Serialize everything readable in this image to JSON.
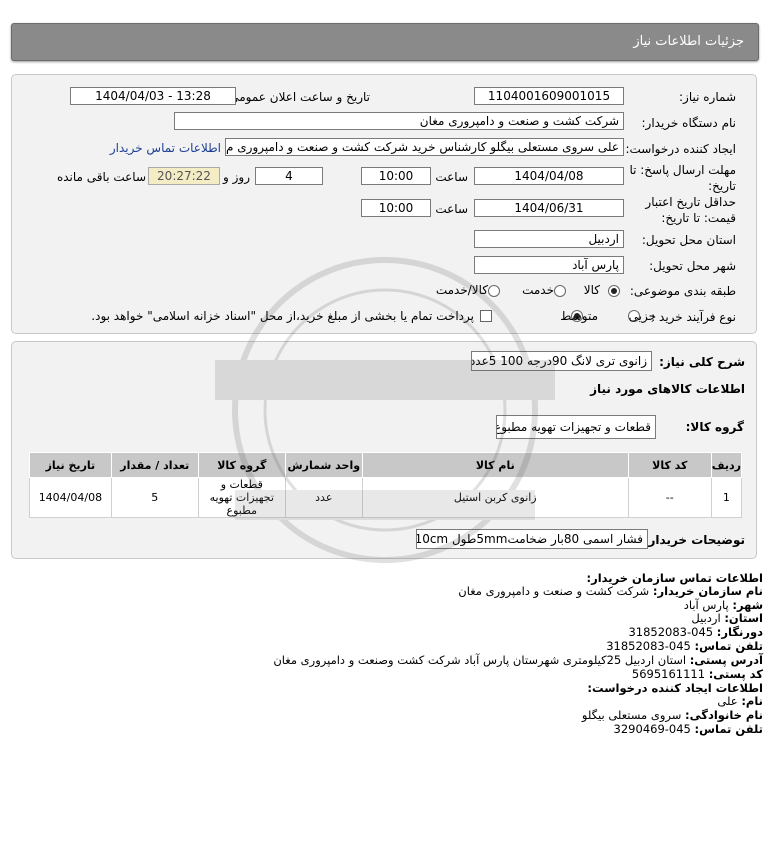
{
  "header": {
    "title": "جزئیات اطلاعات نیاز"
  },
  "details": {
    "need_number_label": "شماره نیاز:",
    "need_number": "1104001609001015",
    "announce_label": "تاریخ و ساعت اعلان عمومی:",
    "announce_value": "1404/04/03 - 13:28",
    "buyer_org_label": "نام دستگاه خریدار:",
    "buyer_org": "شرکت کشت و صنعت و دامپروری مغان",
    "creator_label": "ایجاد کننده درخواست:",
    "creator": "علی سروی مستعلی بیگلو کارشناس خرید شرکت کشت و صنعت و دامپروری م",
    "contact_link": "اطلاعات تماس خریدار",
    "deadline_label_1": "مهلت ارسال پاسخ: تا",
    "deadline_label_2": "تاریخ:",
    "deadline_date": "1404/04/08",
    "time_label": "ساعت",
    "deadline_time": "10:00",
    "days_value": "4",
    "days_label": "روز و",
    "remaining_time": "20:27:22",
    "remaining_label": "ساعت باقی مانده",
    "validity_label_1": "حداقل تاریخ اعتبار",
    "validity_label_2": "قیمت: تا تاریخ:",
    "validity_date": "1404/06/31",
    "validity_time": "10:00",
    "province_label": "استان محل تحویل:",
    "province": "اردبیل",
    "city_label": "شهر محل تحویل:",
    "city": "پارس آباد",
    "category_label": "طبقه بندی موضوعی:",
    "category_options": [
      "کالا",
      "خدمت",
      "کالا/خدمت"
    ],
    "process_label": "نوع فرآیند خرید :",
    "process_options": [
      "جزیی",
      "متوسط"
    ],
    "payment_note": "پرداخت تمام یا بخشی از مبلغ خرید،از محل \"اسناد خزانه اسلامی\" خواهد بود."
  },
  "needs": {
    "summary_label": "شرح کلی نیاز:",
    "summary": "زانوی تری لانگ 90درجه 100 5عدد",
    "goods_info_title": "اطلاعات کالاهای مورد نیاز",
    "group_label": "گروه کالا:",
    "group_value": "قطعات و تجهیزات تهویه مطبوع",
    "table": {
      "headers": [
        "ردیف",
        "کد کالا",
        "نام کالا",
        "واحد شمارش",
        "گروه کالا",
        "تعداد / مقدار",
        "تاریخ نیاز"
      ],
      "rows": [
        {
          "row": "1",
          "code": "--",
          "name": "زانوی کربن استیل",
          "unit": "عدد",
          "group": "قطعات و تجهیزات تهویه مطبوع",
          "qty": "5",
          "date": "1404/04/08"
        }
      ]
    },
    "buyer_notes_label": "توضیحات خریدار:",
    "buyer_notes": "فشار اسمی 80بار ضخامت5mmطول 10cm"
  },
  "contact": {
    "title": "اطلاعات تماس سازمان خریدار:",
    "org_label": "نام سازمان خریدار:",
    "org_value": "شرکت کشت و صنعت و دامپروری مغان",
    "city_label": "شهر:",
    "city_value": "پارس آباد",
    "province_label": "استان:",
    "province_value": "اردبیل",
    "fax_label": "دورنگار:",
    "fax_value": "045-31852083",
    "phone_label": "تلفن تماس:",
    "phone_value": "045-31852083",
    "address_label": "آدرس پستی:",
    "address_value": "استان اردبیل 25کیلومتری شهرستان پارس آباد شرکت کشت وصنعت و دامپروری مغان",
    "postal_label": "کد پستی:",
    "postal_value": "5695161111",
    "creator_title": "اطلاعات ایجاد کننده درخواست:",
    "first_name_label": "نام:",
    "first_name_value": "علی",
    "last_name_label": "نام خانوادگی:",
    "last_name_value": "سروی مستعلی بیگلو",
    "creator_phone_label": "تلفن تماس:",
    "creator_phone_value": "045-3290469"
  }
}
